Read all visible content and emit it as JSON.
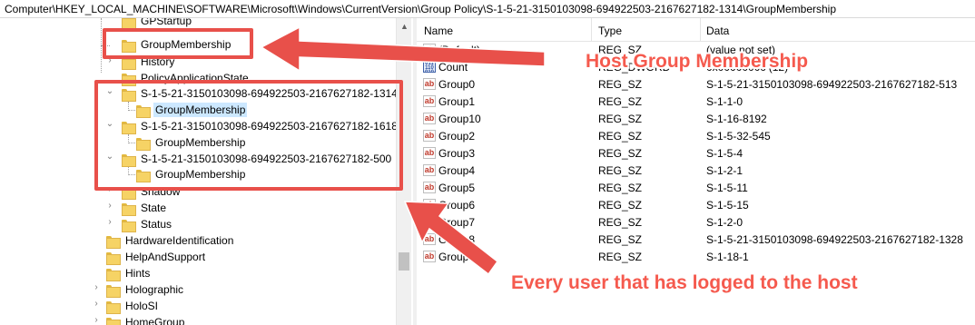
{
  "address": "Computer\\HKEY_LOCAL_MACHINE\\SOFTWARE\\Microsoft\\Windows\\CurrentVersion\\Group Policy\\S-1-5-21-3150103098-694922503-2167627182-1314\\GroupMembership",
  "tree": {
    "items": [
      {
        "label": "GPStartup",
        "expander": ""
      },
      {
        "label": "GroupMembership",
        "expander": ""
      },
      {
        "label": "History",
        "expander": "›"
      },
      {
        "label": "PolicyApplicationState",
        "expander": ""
      },
      {
        "label": "S-1-5-21-3150103098-694922503-2167627182-1314",
        "expander": "⌄"
      },
      {
        "label": "GroupMembership",
        "expander": ""
      },
      {
        "label": "S-1-5-21-3150103098-694922503-2167627182-1618",
        "expander": "⌄"
      },
      {
        "label": "GroupMembership",
        "expander": ""
      },
      {
        "label": "S-1-5-21-3150103098-694922503-2167627182-500",
        "expander": "⌄"
      },
      {
        "label": "GroupMembership",
        "expander": ""
      },
      {
        "label": "Shadow",
        "expander": "›"
      },
      {
        "label": "State",
        "expander": "›"
      },
      {
        "label": "Status",
        "expander": "›"
      },
      {
        "label": "HardwareIdentification",
        "expander": ""
      },
      {
        "label": "HelpAndSupport",
        "expander": ""
      },
      {
        "label": "Hints",
        "expander": ""
      },
      {
        "label": "Holographic",
        "expander": "›"
      },
      {
        "label": "HoloSI",
        "expander": "›"
      },
      {
        "label": "HomeGroup",
        "expander": "›"
      }
    ]
  },
  "columns": {
    "name": "Name",
    "type": "Type",
    "data": "Data"
  },
  "values": [
    {
      "name": "(Default)",
      "type": "REG_SZ",
      "data": "(value not set)",
      "icon": "ab"
    },
    {
      "name": "Count",
      "type": "REG_DWORD",
      "data": "0x0000000c (12)",
      "icon": "bin"
    },
    {
      "name": "Group0",
      "type": "REG_SZ",
      "data": "S-1-5-21-3150103098-694922503-2167627182-513",
      "icon": "ab"
    },
    {
      "name": "Group1",
      "type": "REG_SZ",
      "data": "S-1-1-0",
      "icon": "ab"
    },
    {
      "name": "Group10",
      "type": "REG_SZ",
      "data": "S-1-16-8192",
      "icon": "ab"
    },
    {
      "name": "Group2",
      "type": "REG_SZ",
      "data": "S-1-5-32-545",
      "icon": "ab"
    },
    {
      "name": "Group3",
      "type": "REG_SZ",
      "data": "S-1-5-4",
      "icon": "ab"
    },
    {
      "name": "Group4",
      "type": "REG_SZ",
      "data": "S-1-2-1",
      "icon": "ab"
    },
    {
      "name": "Group5",
      "type": "REG_SZ",
      "data": "S-1-5-11",
      "icon": "ab"
    },
    {
      "name": "Group6",
      "type": "REG_SZ",
      "data": "S-1-5-15",
      "icon": "ab"
    },
    {
      "name": "Group7",
      "type": "REG_SZ",
      "data": "S-1-2-0",
      "icon": "ab"
    },
    {
      "name": "Group8",
      "type": "REG_SZ",
      "data": "S-1-5-21-3150103098-694922503-2167627182-1328",
      "icon": "ab"
    },
    {
      "name": "Group9",
      "type": "REG_SZ",
      "data": "S-1-18-1",
      "icon": "ab"
    }
  ],
  "annotations": {
    "host_group_membership": "Host Group Membership",
    "every_user": "Every user that has logged to the host"
  },
  "colors": {
    "annotation": "#e8504a",
    "selection": "#cce8ff",
    "folder": "#f6d365"
  }
}
